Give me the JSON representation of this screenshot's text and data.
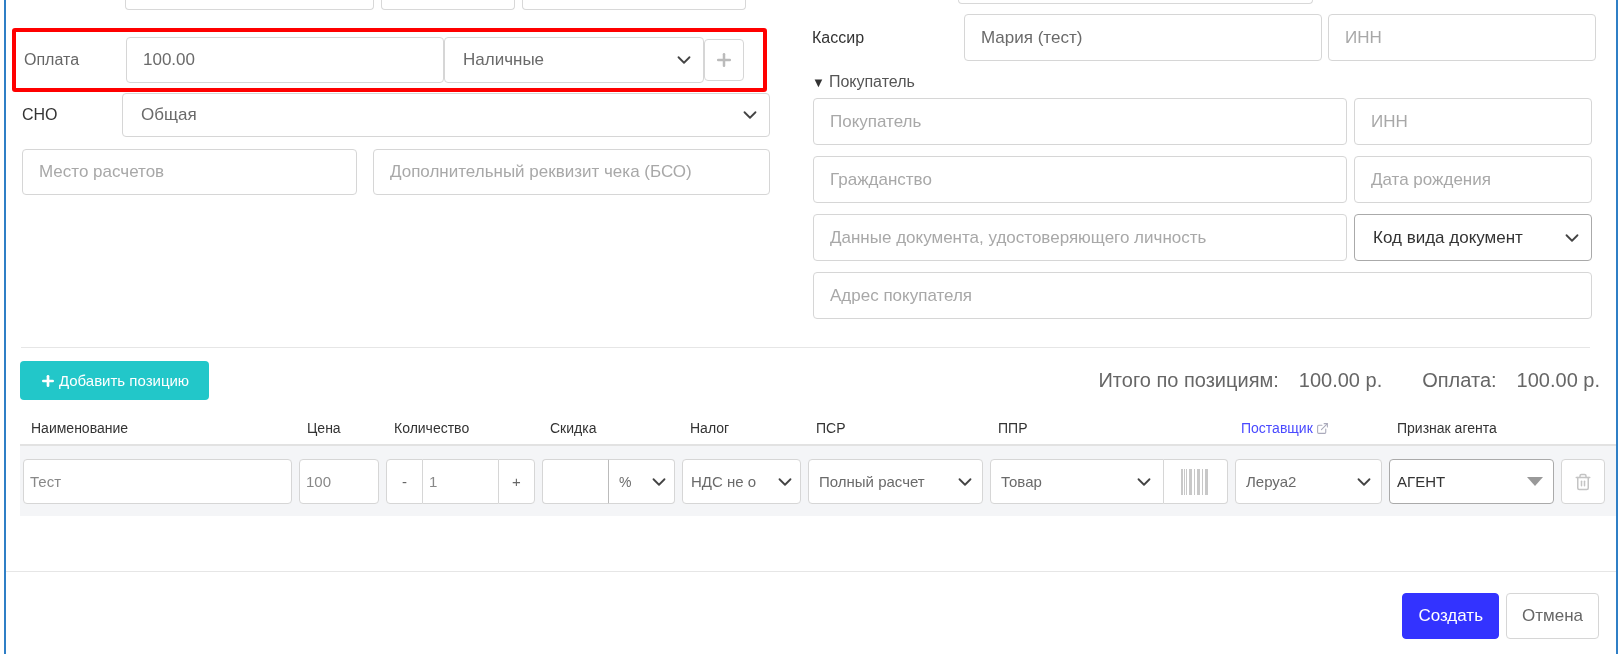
{
  "payment": {
    "label": "Оплата",
    "amount": "100.00",
    "method": "Наличные",
    "highlighted": true
  },
  "tax_system": {
    "label": "СНО",
    "value": "Общая"
  },
  "settlement_place": {
    "placeholder": "Место расчетов"
  },
  "extra_requisite": {
    "placeholder": "Дополнительный реквизит чека (БСО)"
  },
  "cashier": {
    "label": "Кассир",
    "name": "Мария (тест)",
    "inn_placeholder": "ИНН"
  },
  "buyer": {
    "marker": "▼",
    "label": "Покупатель",
    "expanded": true,
    "fields": [
      {
        "kind": "input",
        "placeholder": "Покупатель"
      },
      {
        "kind": "input",
        "placeholder": "ИНН"
      },
      {
        "kind": "input",
        "placeholder": "Гражданство"
      },
      {
        "kind": "input",
        "placeholder": "Дата рождения"
      },
      {
        "kind": "input",
        "placeholder": "Данные документа, удостоверяющего личность"
      },
      {
        "kind": "select",
        "value": "Код вида документ"
      },
      {
        "kind": "wide",
        "placeholder": "Адрес покупателя"
      }
    ]
  },
  "add_item_button": {
    "label": "Добавить позицию"
  },
  "totals": [
    {
      "label": "Итого по позициям:",
      "value": "100.00 р."
    },
    {
      "label": "Оплата:",
      "value": "100.00 р."
    }
  ],
  "table": {
    "columns": [
      {
        "label": "Наименование",
        "kind": "text"
      },
      {
        "label": "Цена",
        "kind": "text"
      },
      {
        "label": "Количество",
        "kind": "text"
      },
      {
        "label": "Скидка",
        "kind": "text"
      },
      {
        "label": "Налог",
        "kind": "text"
      },
      {
        "label": "ПСР",
        "kind": "text"
      },
      {
        "label": "ППР",
        "kind": "text"
      },
      {
        "label": "Поставщик",
        "kind": "link"
      },
      {
        "label": "Признак агента",
        "kind": "text"
      }
    ],
    "rows": [
      {
        "name": "Тест",
        "price": "100",
        "quantity": {
          "minus": "-",
          "value": "1",
          "plus": "+"
        },
        "discount_unit": "%",
        "tax": "НДС не о",
        "settlement_method": "Полный расчет",
        "subject": "Товар",
        "supplier": "Леруа2",
        "agent": "АГЕНТ"
      }
    ]
  },
  "buttons": [
    {
      "label": "Создать",
      "kind": "primary"
    },
    {
      "label": "Отмена",
      "kind": "secondary"
    }
  ]
}
